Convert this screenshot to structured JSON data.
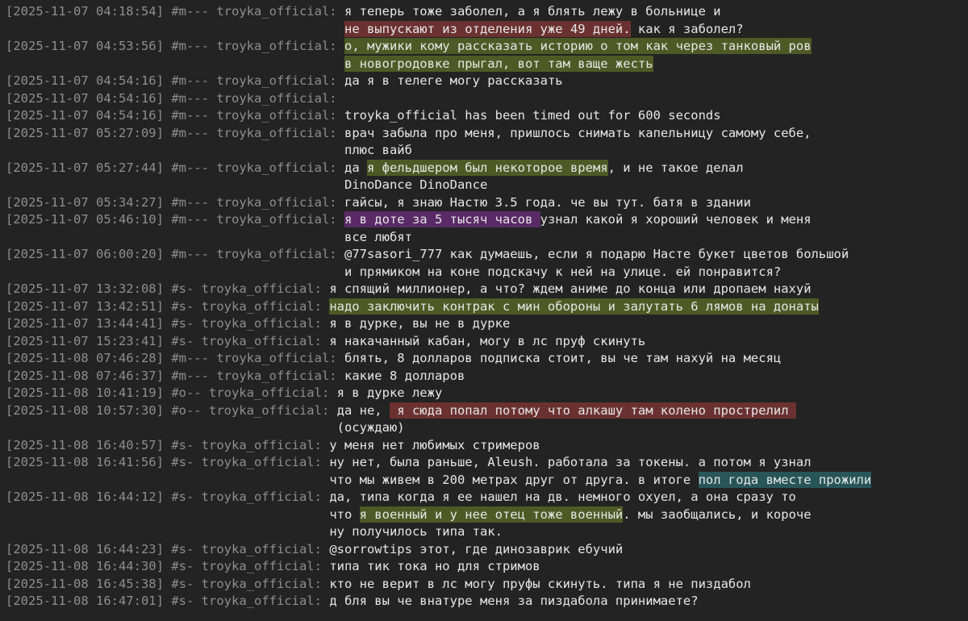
{
  "theme": {
    "background": "#232323",
    "meta_color": "#8e8e8e",
    "text_color": "#e6e6e6",
    "highlight_colors": {
      "red": "#6b3131",
      "olive": "#4e5a25",
      "purple": "#5a2a66",
      "teal": "#275558"
    }
  },
  "messages": [
    {
      "ts": "[2025-11-07 04:18:54]",
      "channel": "#m---",
      "user": "troyka_official:",
      "lines": [
        [
          {
            "t": "я теперь тоже заболел, а я блять лежу в больнице и"
          }
        ],
        [
          {
            "t": "не выпускают из отделения уже 49 дней.",
            "hl": "red"
          },
          {
            "t": " как я заболел?"
          }
        ]
      ]
    },
    {
      "ts": "[2025-11-07 04:53:56]",
      "channel": "#m---",
      "user": "troyka_official:",
      "lines": [
        [
          {
            "t": "о, мужики кому рассказать историю о том как через танковый ров",
            "hl": "olive"
          }
        ],
        [
          {
            "t": "в новогродовке прыгал, вот там ваще жесть",
            "hl": "olive"
          }
        ]
      ]
    },
    {
      "ts": "[2025-11-07 04:54:16]",
      "channel": "#m---",
      "user": "troyka_official:",
      "lines": [
        [
          {
            "t": "да я в телеге могу рассказать"
          }
        ]
      ]
    },
    {
      "ts": "[2025-11-07 04:54:16]",
      "channel": "#m---",
      "user": "troyka_official:",
      "lines": [
        [
          {
            "t": ""
          }
        ]
      ]
    },
    {
      "ts": "[2025-11-07 04:54:16]",
      "channel": "#m---",
      "user": "troyka_official:",
      "lines": [
        [
          {
            "t": "troyka_official has been timed out for 600 seconds"
          }
        ]
      ]
    },
    {
      "ts": "[2025-11-07 05:27:09]",
      "channel": "#m---",
      "user": "troyka_official:",
      "lines": [
        [
          {
            "t": "врач забыла про меня, пришлось снимать капельницу самому себе,"
          }
        ],
        [
          {
            "t": "плюс вайб"
          }
        ]
      ]
    },
    {
      "ts": "[2025-11-07 05:27:44]",
      "channel": "#m---",
      "user": "troyka_official:",
      "lines": [
        [
          {
            "t": "да "
          },
          {
            "t": "я фельдшером был некоторое время",
            "hl": "olive"
          },
          {
            "t": ", и не такое делал"
          }
        ],
        [
          {
            "t": "DinoDance DinoDance"
          }
        ]
      ]
    },
    {
      "ts": "[2025-11-07 05:34:27]",
      "channel": "#m---",
      "user": "troyka_official:",
      "lines": [
        [
          {
            "t": "гайсы, я знаю Настю 3.5 года. че вы тут. батя в здании"
          }
        ]
      ]
    },
    {
      "ts": "[2025-11-07 05:46:10]",
      "channel": "#m---",
      "user": "troyka_official:",
      "lines": [
        [
          {
            "t": "я в доте за 5 тысяч часов ",
            "hl": "purple"
          },
          {
            "t": "узнал какой я хороший человек и меня"
          }
        ],
        [
          {
            "t": "все любят"
          }
        ]
      ]
    },
    {
      "ts": "[2025-11-07 06:00:20]",
      "channel": "#m---",
      "user": "troyka_official:",
      "lines": [
        [
          {
            "t": "@77sasori_777 как думаешь, если я подарю Насте букет цветов большой"
          }
        ],
        [
          {
            "t": "и прямиком на коне подскачу к ней на улице. ей понравится?"
          }
        ]
      ]
    },
    {
      "ts": "[2025-11-07 13:32:08]",
      "channel": "#s-",
      "user": "troyka_official:",
      "lines": [
        [
          {
            "t": "я спящий миллионер, а что? ждем аниме до конца или дропаем нахуй"
          }
        ]
      ]
    },
    {
      "ts": "[2025-11-07 13:42:51]",
      "channel": "#s-",
      "user": "troyka_official:",
      "lines": [
        [
          {
            "t": "надо заключить контрак с мин обороны и залутать 6 лямов на донаты",
            "hl": "olive"
          }
        ]
      ]
    },
    {
      "ts": "[2025-11-07 13:44:41]",
      "channel": "#s-",
      "user": "troyka_official:",
      "lines": [
        [
          {
            "t": "я в дурке, вы не в дурке"
          }
        ]
      ]
    },
    {
      "ts": "[2025-11-07 15:23:41]",
      "channel": "#s-",
      "user": "troyka_official:",
      "lines": [
        [
          {
            "t": "я накачанный кабан, могу в лс пруф скинуть"
          }
        ]
      ]
    },
    {
      "ts": "[2025-11-08 07:46:28]",
      "channel": "#m---",
      "user": "troyka_official:",
      "lines": [
        [
          {
            "t": "блять, 8 долларов подписка стоит, вы че там нахуй на месяц"
          }
        ]
      ]
    },
    {
      "ts": "[2025-11-08 07:46:37]",
      "channel": "#m---",
      "user": "troyka_official:",
      "lines": [
        [
          {
            "t": "какие 8 долларов"
          }
        ]
      ]
    },
    {
      "ts": "[2025-11-08 10:41:19]",
      "channel": "#o--",
      "user": "troyka_official:",
      "lines": [
        [
          {
            "t": "я в дурке лежу"
          }
        ]
      ]
    },
    {
      "ts": "[2025-11-08 10:57:30]",
      "channel": "#o--",
      "user": "troyka_official:",
      "lines": [
        [
          {
            "t": "да не, "
          },
          {
            "t": " я сюда попал потому что алкашу там колено прострелил ",
            "hl": "red"
          }
        ],
        [
          {
            "t": "(осуждаю)"
          }
        ]
      ]
    },
    {
      "ts": "[2025-11-08 16:40:57]",
      "channel": "#s-",
      "user": "troyka_official:",
      "lines": [
        [
          {
            "t": "у меня нет любимых стримеров"
          }
        ]
      ]
    },
    {
      "ts": "[2025-11-08 16:41:56]",
      "channel": "#s-",
      "user": "troyka_official:",
      "lines": [
        [
          {
            "t": "ну нет, была раньше, Aleush. работала за токены. а потом я узнал"
          }
        ],
        [
          {
            "t": "что мы живем в 200 метрах друг от друга. в итоге "
          },
          {
            "t": "пол года вместе прожили",
            "hl": "teal"
          }
        ]
      ]
    },
    {
      "ts": "[2025-11-08 16:44:12]",
      "channel": "#s-",
      "user": "troyka_official:",
      "lines": [
        [
          {
            "t": "да, типа когда я ее нашел на дв. немного охуел, а она сразу то"
          }
        ],
        [
          {
            "t": "что "
          },
          {
            "t": "я военный и у нее отец тоже военный",
            "hl": "olive"
          },
          {
            "t": ". мы заобщались, и короче"
          }
        ],
        [
          {
            "t": "ну получилось типа так."
          }
        ]
      ]
    },
    {
      "ts": "[2025-11-08 16:44:23]",
      "channel": "#s-",
      "user": "troyka_official:",
      "lines": [
        [
          {
            "t": "@sorrowtips этот, где динозаврик ебучий"
          }
        ]
      ]
    },
    {
      "ts": "[2025-11-08 16:44:30]",
      "channel": "#s-",
      "user": "troyka_official:",
      "lines": [
        [
          {
            "t": "типа тик тока но для стримов"
          }
        ]
      ]
    },
    {
      "ts": "[2025-11-08 16:45:38]",
      "channel": "#s-",
      "user": "troyka_official:",
      "lines": [
        [
          {
            "t": "кто не верит в лс могу пруфы скинуть. типа я не пиздабол"
          }
        ]
      ]
    },
    {
      "ts": "[2025-11-08 16:47:01]",
      "channel": "#s-",
      "user": "troyka_official:",
      "lines": [
        [
          {
            "t": "д бля вы че внатуре меня за пиздабола принимаете?"
          }
        ]
      ]
    }
  ]
}
